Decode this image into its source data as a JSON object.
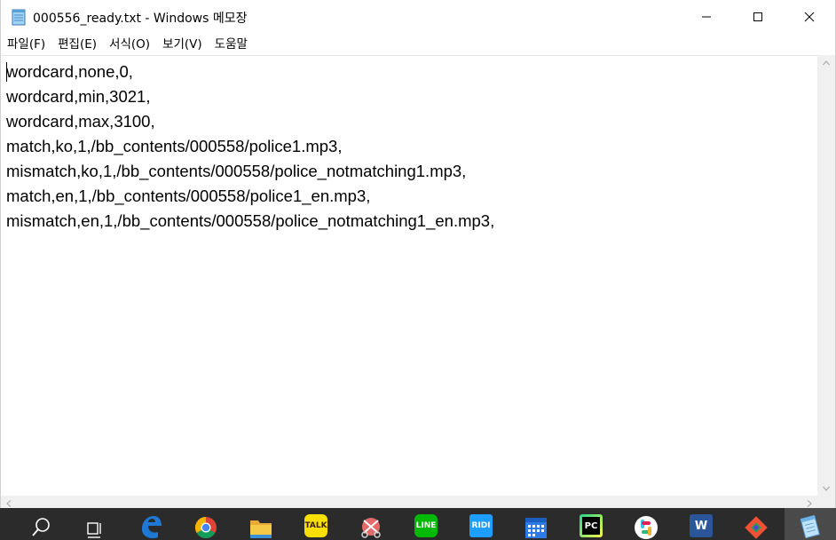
{
  "window": {
    "title": "000556_ready.txt - Windows 메모장"
  },
  "menu": {
    "items": [
      {
        "label": "파일(F)"
      },
      {
        "label": "편집(E)"
      },
      {
        "label": "서식(O)"
      },
      {
        "label": "보기(V)"
      },
      {
        "label": "도움말"
      }
    ]
  },
  "editor": {
    "lines": [
      "wordcard,none,0,",
      "wordcard,min,3021,",
      "wordcard,max,3100,",
      "match,ko,1,/bb_contents/000558/police1.mp3,",
      "mismatch,ko,1,/bb_contents/000558/police_notmatching1.mp3,",
      "match,en,1,/bb_contents/000558/police1_en.mp3,",
      "mismatch,en,1,/bb_contents/000558/police_notmatching1_en.mp3,"
    ]
  },
  "taskbar": {
    "items": [
      {
        "icon": "search-icon"
      },
      {
        "icon": "task-view-icon"
      },
      {
        "icon": "edge-icon",
        "color": "#1e6fd9"
      },
      {
        "icon": "chrome-icon"
      },
      {
        "icon": "file-explorer-icon",
        "color": "#f5c242"
      },
      {
        "icon": "kakaotalk-icon",
        "label": "TALK",
        "color": "#f9e000"
      },
      {
        "icon": "snipping-tool-icon"
      },
      {
        "icon": "line-icon",
        "label": "LINE",
        "color": "#00b900"
      },
      {
        "icon": "ridi-icon",
        "label": "RIDI",
        "color": "#1e9eff"
      },
      {
        "icon": "calendar-icon",
        "color": "#2d7be5"
      },
      {
        "icon": "pycharm-icon",
        "label": "PC",
        "color": "#21d789"
      },
      {
        "icon": "slack-icon"
      },
      {
        "icon": "word-icon",
        "label": "W",
        "color": "#2b579a"
      },
      {
        "icon": "git-icon"
      },
      {
        "icon": "notepad-icon"
      }
    ]
  }
}
